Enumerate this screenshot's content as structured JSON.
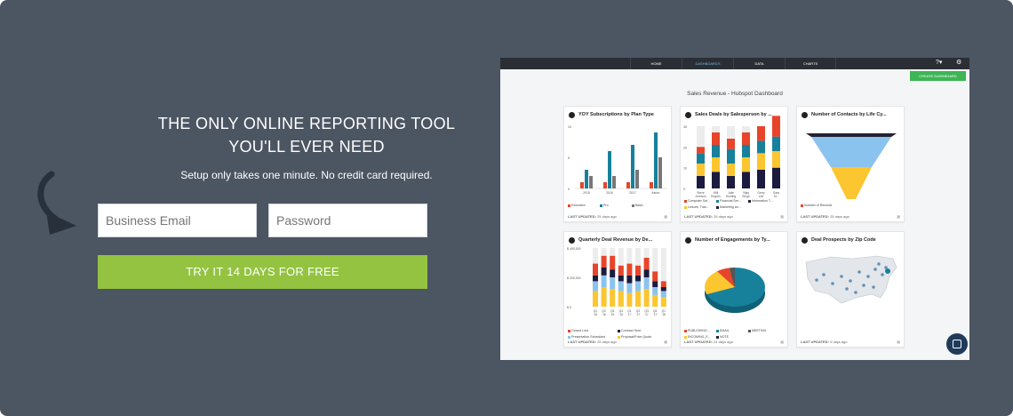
{
  "hero": {
    "headline_line1": "THE ONLY ONLINE REPORTING TOOL",
    "headline_line2": "YOU'LL EVER NEED",
    "subline": "Setup only takes one minute. No credit card required.",
    "email_placeholder": "Business Email",
    "password_placeholder": "Password",
    "cta_label": "TRY IT 14 DAYS FOR FREE",
    "arrow_icon": "curved-arrow-icon"
  },
  "colors": {
    "background": "#4c5562",
    "cta": "#94c341",
    "create_button": "#3cb655"
  },
  "dashboard": {
    "nav": [
      "HOME",
      "DASHBOARDS",
      "DATA",
      "CHARTS"
    ],
    "active_nav": "DASHBOARDS",
    "help_icon": "?▾",
    "settings_icon": "⚙",
    "create_label": "CREATE DASHBOARD",
    "title": "Sales Revenue - Hubspot Dashboard",
    "cards": [
      {
        "title": "YOY Subscriptions by Plan Type",
        "footer_label": "LAST UPDATED:",
        "footer_value": "25 days ago",
        "legend": [
          "Executive",
          "Pro",
          "Basic"
        ]
      },
      {
        "title": "Sales Deals by Salesperson by ...",
        "footer_label": "LAST UPDATED:",
        "footer_value": "25 days ago",
        "legend": [
          "Computer Sof...",
          "Financial Ser...",
          "Information T...",
          "Leisure, Trav...",
          "Marketing an..."
        ]
      },
      {
        "title": "Number of Contacts by Life Cy...",
        "footer_label": "LAST UPDATED:",
        "footer_value": "25 days ago",
        "legend": [
          "Number of Records of Life Cycle Stage"
        ]
      },
      {
        "title": "Quarterly Deal Revenue by De...",
        "footer_label": "LAST UPDATED:",
        "footer_value": "25 days ago",
        "legend": [
          "Closed Lost",
          "Contract Sent",
          "Presentation Scheduled",
          "Proposal/Price Quote"
        ]
      },
      {
        "title": "Number of Engagements by Ty...",
        "footer_label": "LAST UPDATED:",
        "footer_value": "24 days ago",
        "legend": [
          "PUBLISHING...",
          "EMAIL",
          "MEETING",
          "INCOMING_E...",
          "NOTE"
        ]
      },
      {
        "title": "Deal Prospects by Zip Code",
        "footer_label": "LAST UPDATED:",
        "footer_value": "9 days ago",
        "legend": []
      }
    ]
  },
  "chart_data": [
    {
      "type": "bar",
      "title": "YOY Subscriptions by Plan Type",
      "categories": [
        "2015",
        "2016",
        "2017",
        "future"
      ],
      "ylim": [
        0,
        10
      ],
      "yticks": [
        "10",
        "5",
        "0"
      ],
      "series": [
        {
          "name": "Executive",
          "values": [
            1,
            1,
            1,
            1
          ],
          "color": "#e8442a"
        },
        {
          "name": "Pro",
          "values": [
            3,
            6,
            7,
            9
          ],
          "color": "#17819b"
        },
        {
          "name": "Basic",
          "values": [
            2,
            2,
            3,
            5
          ],
          "color": "#777777"
        }
      ]
    },
    {
      "type": "bar",
      "title": "Sales Deals by Salesperson by ...",
      "categories": [
        "Steve Johnson",
        "Will Rogers",
        "Julie Hunting",
        "Vijay Singh",
        "Gerry Lee",
        "Sara St..."
      ],
      "yticks": [
        "30",
        "20",
        "10",
        "0"
      ],
      "ylim": [
        0,
        30
      ]
    },
    {
      "type": "funnel",
      "title": "Number of Contacts by Life Cy...",
      "stages": [
        "#222233",
        "#8bc3ef",
        "#fcc630"
      ]
    },
    {
      "type": "bar",
      "title": "Quarterly Deal Revenue by De...",
      "categories": [
        "Q1 '16",
        "Q2 '16",
        "Q3 '16",
        "Q4 '16",
        "Q1 '17",
        "Q2 '17",
        "Q3 '17",
        "Q4 '17",
        "Q1 '18"
      ],
      "yticks": [
        "$ 400,000",
        "$ 200,000",
        "$ 0"
      ],
      "ylim": [
        0,
        400000
      ]
    },
    {
      "type": "pie",
      "title": "Number of Engagements by Ty...",
      "values": [
        69,
        21,
        7,
        3
      ],
      "colors": [
        "#17819b",
        "#fcc630",
        "#e8442a",
        "#555555"
      ]
    },
    {
      "type": "map",
      "title": "Deal Prospects by Zip Code"
    }
  ]
}
